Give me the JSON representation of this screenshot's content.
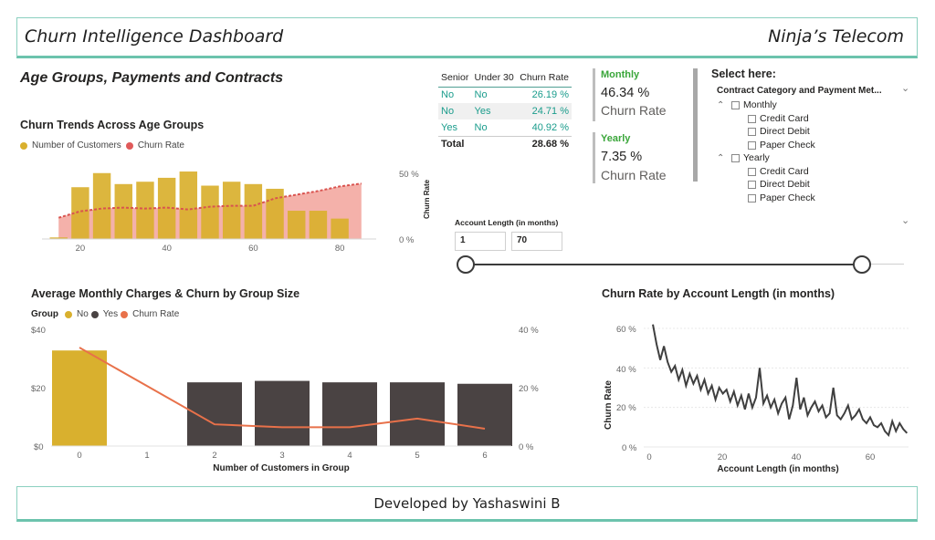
{
  "header": {
    "title": "Churn Intelligence Dashboard",
    "company": "Ninja’s Telecom"
  },
  "footer": {
    "text": "Developed by Yashaswini B"
  },
  "section_title": "Age Groups, Payments and Contracts",
  "age_chart": {
    "title": "Churn Trends Across Age Groups",
    "legend": [
      "Number of Customers",
      "Churn Rate"
    ],
    "y2_label": "Churn Rate",
    "y2_ticks": [
      "50 %",
      "0 %"
    ],
    "x_ticks": [
      "20",
      "40",
      "60",
      "80"
    ]
  },
  "group_chart": {
    "title": "Average Monthly Charges & Churn by Group Size",
    "legend_title": "Group",
    "legend": [
      "No",
      "Yes",
      "Churn Rate"
    ],
    "y_ticks": [
      "$40",
      "$20",
      "$0"
    ],
    "y2_ticks": [
      "40 %",
      "20 %",
      "0 %"
    ],
    "x_label": "Number of Customers in Group"
  },
  "length_chart": {
    "title": "Churn Rate by Account Length (in months)",
    "y_label": "Churn Rate",
    "x_label": "Account Length (in months)",
    "y_ticks": [
      "60 %",
      "40 %",
      "20 %",
      "0 %"
    ],
    "x_ticks": [
      "0",
      "20",
      "40",
      "60"
    ]
  },
  "senior_table": {
    "headers": [
      "Senior",
      "Under 30",
      "Churn Rate"
    ],
    "rows": [
      [
        "No",
        "No",
        "26.19 %"
      ],
      [
        "No",
        "Yes",
        "24.71 %"
      ],
      [
        "Yes",
        "No",
        "40.92 %"
      ]
    ],
    "total_label": "Total",
    "total_value": "28.68 %"
  },
  "cards": {
    "monthly": {
      "label": "Monthly",
      "value": "46.34 %",
      "sub": "Churn Rate"
    },
    "yearly": {
      "label": "Yearly",
      "value": "7.35 %",
      "sub": "Churn Rate"
    }
  },
  "slicer": {
    "title": "Select here:",
    "header": "Contract Category and Payment Met...",
    "groups": [
      {
        "label": "Monthly",
        "children": [
          "Credit Card",
          "Direct Debit",
          "Paper Check"
        ]
      },
      {
        "label": "Yearly",
        "children": [
          "Credit Card",
          "Direct Debit",
          "Paper Check"
        ]
      }
    ]
  },
  "range": {
    "title": "Account Length (in months)",
    "min": "1",
    "max": "70"
  },
  "colors": {
    "gold": "#d9b02e",
    "teal": "#6cc3ad",
    "dark": "#4a4343",
    "orange": "#e8714a",
    "coral": "#e05a5a",
    "green": "#3aa63a"
  },
  "chart_data": [
    {
      "type": "bar",
      "title": "Churn Trends Across Age Groups",
      "x": [
        15,
        20,
        25,
        30,
        35,
        40,
        45,
        50,
        55,
        60,
        65,
        70,
        75,
        80,
        85
      ],
      "series": [
        {
          "name": "Number of Customers",
          "values": [
            2,
            66,
            84,
            70,
            73,
            78,
            86,
            68,
            73,
            70,
            64,
            36,
            36,
            26,
            0
          ]
        },
        {
          "name": "Churn Rate",
          "values": [
            23,
            30,
            33,
            34,
            33,
            34,
            32,
            35,
            36,
            36,
            44,
            48,
            52,
            57,
            60
          ]
        }
      ],
      "xlim": [
        12,
        88
      ],
      "ylim": [
        0,
        100
      ],
      "y2lim": [
        0,
        85
      ]
    },
    {
      "type": "bar",
      "title": "Average Monthly Charges & Churn by Group Size",
      "categories": [
        "0",
        "1",
        "2",
        "3",
        "4",
        "5",
        "6"
      ],
      "series": [
        {
          "name": "No",
          "values": [
            33,
            null,
            null,
            null,
            null,
            null,
            null
          ]
        },
        {
          "name": "Yes",
          "values": [
            null,
            null,
            22,
            22.5,
            22,
            22,
            21.5
          ]
        },
        {
          "name": "Churn Rate",
          "values": [
            34,
            null,
            7.5,
            6.5,
            6.5,
            9.5,
            6
          ]
        }
      ],
      "ylim": [
        0,
        40
      ],
      "y2lim": [
        0,
        40
      ]
    },
    {
      "type": "line",
      "title": "Churn Rate by Account Length (in months)",
      "x": [
        1,
        2,
        3,
        4,
        5,
        6,
        7,
        8,
        9,
        10,
        11,
        12,
        13,
        14,
        15,
        16,
        17,
        18,
        19,
        20,
        21,
        22,
        23,
        24,
        25,
        26,
        27,
        28,
        29,
        30,
        31,
        32,
        33,
        34,
        35,
        36,
        37,
        38,
        39,
        40,
        41,
        42,
        43,
        44,
        45,
        46,
        47,
        48,
        49,
        50,
        51,
        52,
        53,
        54,
        55,
        56,
        57,
        58,
        59,
        60,
        61,
        62,
        63,
        64,
        65,
        66,
        67,
        68,
        69,
        70
      ],
      "y": [
        62,
        52,
        44,
        51,
        43,
        38,
        41,
        34,
        39,
        31,
        37,
        32,
        36,
        29,
        34,
        27,
        31,
        24,
        30,
        27,
        29,
        23,
        28,
        21,
        26,
        19,
        27,
        20,
        25,
        40,
        22,
        26,
        20,
        24,
        17,
        22,
        25,
        14,
        21,
        35,
        19,
        25,
        16,
        20,
        23,
        18,
        21,
        15,
        17,
        30,
        16,
        14,
        17,
        21,
        14,
        16,
        19,
        14,
        12,
        15,
        11,
        10,
        12,
        8,
        6,
        13,
        8,
        12,
        9,
        7
      ],
      "xlim": [
        -3,
        72
      ],
      "ylim": [
        0,
        65
      ]
    }
  ]
}
